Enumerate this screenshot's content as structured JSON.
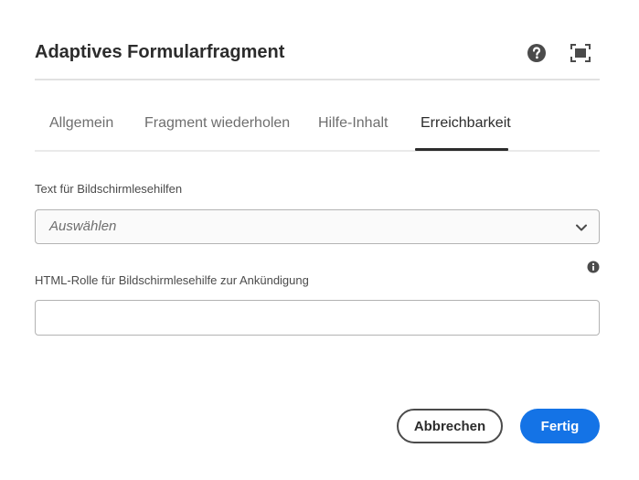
{
  "dialog": {
    "title": "Adaptives Formularfragment",
    "icons": {
      "help": "help-icon",
      "fullscreen": "fullscreen-icon"
    }
  },
  "tabs": [
    {
      "label": "Allgemein",
      "selected": false
    },
    {
      "label": "Fragment wiederholen",
      "selected": false
    },
    {
      "label": "Hilfe-Inhalt",
      "selected": false
    },
    {
      "label": "Erreichbarkeit",
      "selected": true
    }
  ],
  "form": {
    "screen_reader_text_label": "Text für Bildschirmlesehilfen",
    "screen_reader_text_value": "Auswählen",
    "html_role_label": "HTML-Rolle für Bildschirmlesehilfe zur Ankündigung",
    "html_role_value": "",
    "info_icon": "info-icon"
  },
  "footer": {
    "cancel_label": "Abbrechen",
    "done_label": "Fertig"
  },
  "colors": {
    "accent": "#1473e6",
    "text": "#2c2c2c",
    "muted": "#6e6e6e"
  }
}
